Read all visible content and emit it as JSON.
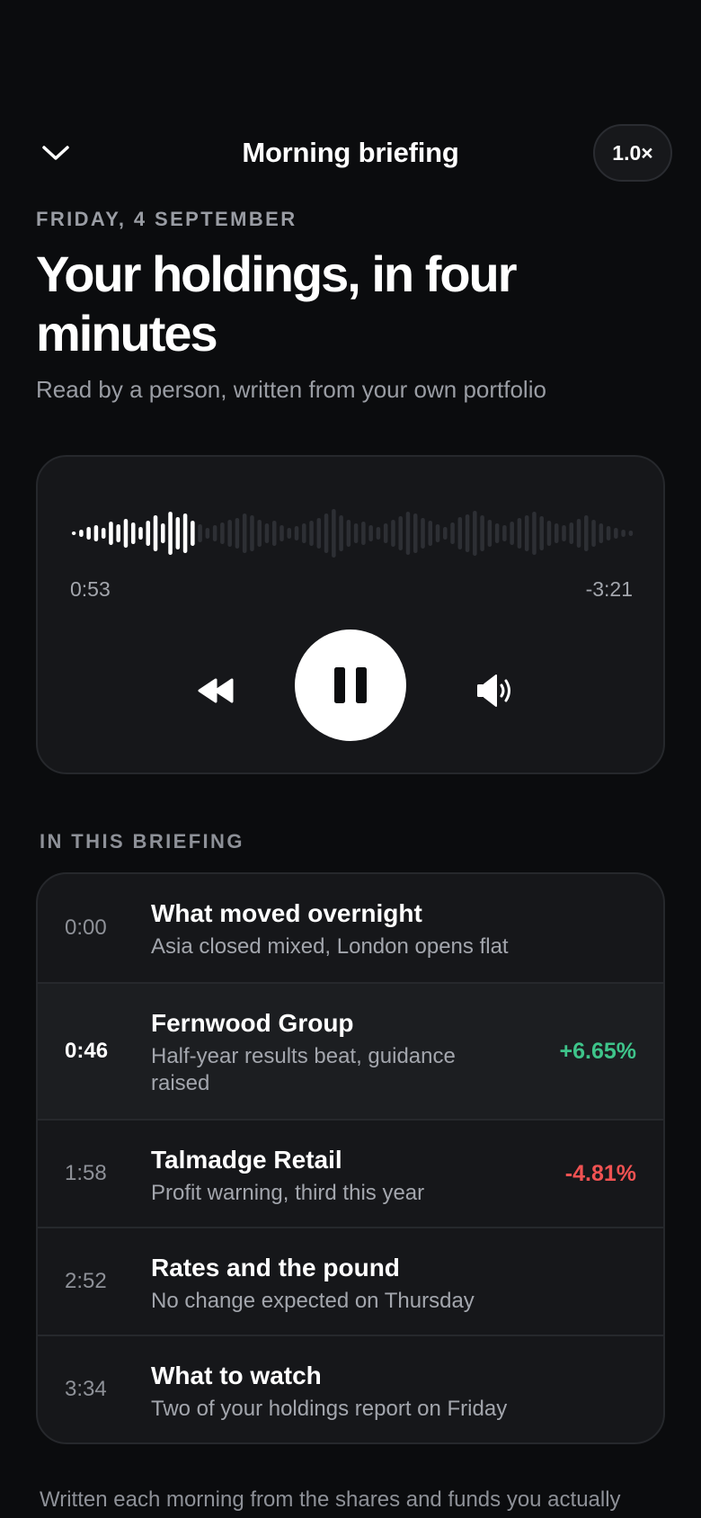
{
  "header": {
    "title": "Morning briefing",
    "speed_label": "1.0×"
  },
  "briefing": {
    "date": "FRIDAY, 4 SEPTEMBER",
    "headline": "Your holdings, in four minutes",
    "subtitle": "Read by a person, written from your own portfolio"
  },
  "player": {
    "elapsed": "0:53",
    "remaining": "-3:21",
    "progress": 0.22,
    "state": "playing",
    "colors": {
      "played": "#ffffff",
      "unplayed": "#2d2f34"
    }
  },
  "chapters": {
    "label": "IN THIS BRIEFING",
    "items": [
      {
        "time": "0:00",
        "title": "What moved overnight",
        "subtitle": "Asia closed mixed, London opens flat",
        "change": "",
        "active": false
      },
      {
        "time": "0:46",
        "title": "Fernwood Group",
        "subtitle": "Half-year results beat, guidance raised",
        "change": "+6.65%",
        "active": true
      },
      {
        "time": "1:58",
        "title": "Talmadge Retail",
        "subtitle": "Profit warning, third this year",
        "change": "-4.81%",
        "active": false
      },
      {
        "time": "2:52",
        "title": "Rates and the pound",
        "subtitle": "No change expected on Thursday",
        "change": "",
        "active": false
      },
      {
        "time": "3:34",
        "title": "What to watch",
        "subtitle": "Two of your holdings report on Friday",
        "change": "",
        "active": false
      }
    ]
  },
  "colors": {
    "positive": "#3ec48a",
    "negative": "#f05252"
  },
  "footer": {
    "note": "Written each morning from the shares and funds you actually"
  }
}
